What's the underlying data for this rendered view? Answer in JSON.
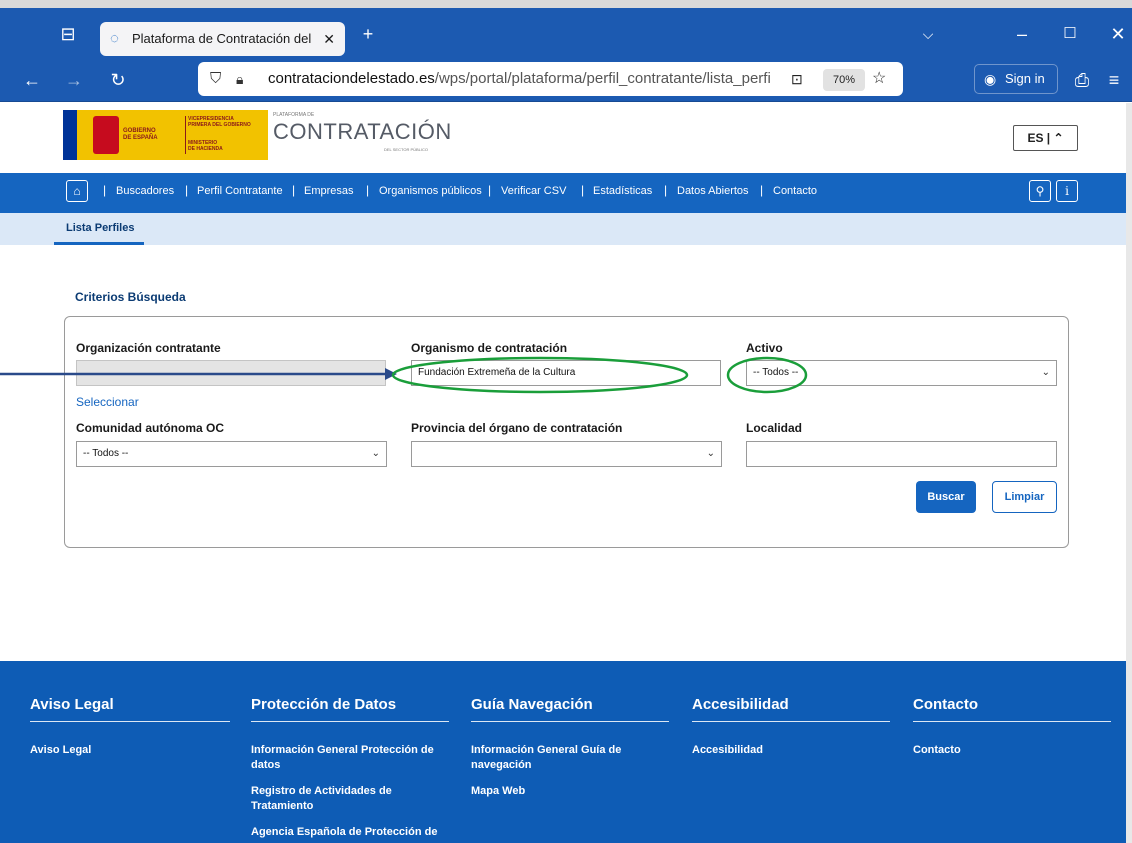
{
  "browser": {
    "tab_title": "Plataforma de Contratación del",
    "url_domain": "contrataciondelestado.es",
    "url_path": "/wps/portal/plataforma/perfil_contratante/lista_perfi",
    "zoom": "70%",
    "sign_in": "Sign in"
  },
  "header": {
    "gov_line1": "GOBIERNO",
    "gov_line2": "DE ESPAÑA",
    "vice_line1": "VICEPRESIDENCIA",
    "vice_line2": "PRIMERA DEL GOBIERNO",
    "min_line1": "MINISTERIO",
    "min_line2": "DE HACIENDA",
    "brand_small": "PLATAFORMA DE",
    "brand": "CONTRATACIÓN",
    "brand_sub": "DEL SECTOR PÚBLICO",
    "language": "ES |"
  },
  "nav": {
    "items": [
      "Buscadores",
      "Perfil Contratante",
      "Empresas",
      "Organismos públicos",
      "Verificar CSV",
      "Estadísticas",
      "Datos Abiertos",
      "Contacto"
    ]
  },
  "subnav": {
    "active": "Lista Perfiles"
  },
  "search": {
    "title": "Criterios Búsqueda",
    "org_label": "Organización contratante",
    "org_value": "",
    "select_link": "Seleccionar",
    "organismo_label": "Organismo de contratación",
    "organismo_value": "Fundación Extremeña de la Cultura",
    "activo_label": "Activo",
    "activo_value": "-- Todos --",
    "ccaa_label": "Comunidad autónoma OC",
    "ccaa_value": "-- Todos --",
    "provincia_label": "Provincia del órgano de contratación",
    "provincia_value": "",
    "localidad_label": "Localidad",
    "localidad_value": "",
    "search_button": "Buscar",
    "clear_button": "Limpiar"
  },
  "footer": {
    "col1": {
      "title": "Aviso Legal",
      "links": [
        "Aviso Legal"
      ]
    },
    "col2": {
      "title": "Protección de Datos",
      "links": [
        "Información General Protección de datos",
        "Registro de Actividades de Tratamiento",
        "Agencia Española de Protección de"
      ]
    },
    "col3": {
      "title": "Guía Navegación",
      "links": [
        "Información General Guía de navegación",
        "Mapa Web"
      ]
    },
    "col4": {
      "title": "Accesibilidad",
      "links": [
        "Accesibilidad"
      ]
    },
    "col5": {
      "title": "Contacto",
      "links": [
        "Contacto"
      ]
    }
  },
  "colors": {
    "nav_blue": "#1565c0",
    "footer_blue": "#0e5cb5",
    "annotation_green": "#1a9e3a",
    "annotation_arrow": "#2a4a8a"
  }
}
